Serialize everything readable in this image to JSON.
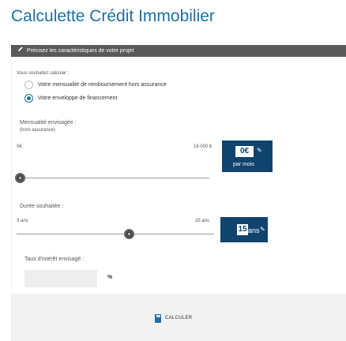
{
  "page": {
    "title": "Calculette Crédit Immobilier"
  },
  "section": {
    "header": "Précisez les caractéristiques de votre projet"
  },
  "calc_type": {
    "label": "Vous souhaitez calculer :",
    "options": [
      {
        "label": "Votre mensualité de remboursement hors assurance",
        "checked": false
      },
      {
        "label": "Votre enveloppe de financement",
        "checked": true
      }
    ]
  },
  "monthly": {
    "label": "Mensualité envisagée :",
    "sublabel": "(hors assurance)",
    "min_label": "0€",
    "max_label": "18 000 €",
    "value": "0",
    "currency": "€",
    "unit": "par mois",
    "slider_fraction": 0.0
  },
  "duration": {
    "label": "Durée souhaitée :",
    "min_label": "3 ans",
    "max_label": "25 ans",
    "value": "15",
    "unit": "ans",
    "slider_fraction": 0.55
  },
  "rate": {
    "label": "Taux d'intérêt envisagé :",
    "value": "",
    "unit": "%"
  },
  "footer": {
    "calculate_label": "CALCULER"
  },
  "colors": {
    "title": "#1f6fa3",
    "box": "#10436e",
    "section_bar": "#595959"
  },
  "icons": {
    "pencil": "pencil-icon",
    "calculator": "calculator-icon"
  }
}
